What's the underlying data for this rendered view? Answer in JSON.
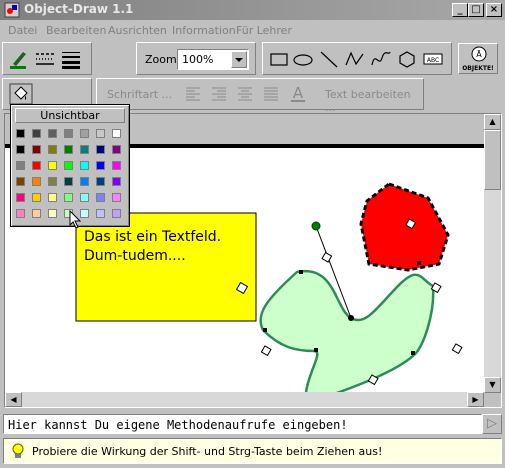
{
  "window": {
    "title": "Object-Draw 1.1"
  },
  "menu": [
    {
      "label": "Datei"
    },
    {
      "label": "Bearbeiten"
    },
    {
      "label": "Ausrichten"
    },
    {
      "label": "Information"
    },
    {
      "label": "Für Lehrer"
    }
  ],
  "toolbar": {
    "zoom_label": "Zoom:",
    "zoom_value": "100%",
    "objects_label": "OBJEKTE!"
  },
  "toolbar2": {
    "font_label": "Schriftart ...",
    "text_edit_label": "Text bearbeiten ..."
  },
  "color_popup": {
    "title": "Unsichtbar",
    "colors": [
      [
        "#000000",
        "#404040",
        "#606060",
        "#808080",
        "#a0a0a0",
        "#c8c8c8",
        "#ffffff"
      ],
      [
        "#000000",
        "#800000",
        "#808000",
        "#008000",
        "#008080",
        "#000080",
        "#800080"
      ],
      [
        "#808080",
        "#ff0000",
        "#ffff00",
        "#00ff00",
        "#00ffff",
        "#0000ff",
        "#ff00ff"
      ],
      [
        "#804000",
        "#ff8000",
        "#808040",
        "#004040",
        "#0080ff",
        "#004080",
        "#8000ff"
      ],
      [
        "#ff0080",
        "#ffcc00",
        "#ffff80",
        "#80ff80",
        "#80ffff",
        "#8080ff",
        "#ff80ff"
      ],
      [
        "#ff80c0",
        "#ffcc99",
        "#ffffc0",
        "#c0ffc0",
        "#c0ffff",
        "#c0c0ff",
        "#c0a0ff"
      ]
    ]
  },
  "canvas": {
    "textbox_line1": "Das ist ein Textfeld.",
    "textbox_line2": "Dum-tudem....",
    "textbox_color": "#ffff00",
    "hexagon_color": "#ff0000",
    "blob_color": "#ccffcc",
    "blob_outline": "#2e8b57"
  },
  "method_field": {
    "value": "Hier kannst Du eigene Methodenaufrufe eingeben!"
  },
  "hint": {
    "text": "Probiere die Wirkung der Shift- und Strg-Taste beim Ziehen aus!"
  }
}
